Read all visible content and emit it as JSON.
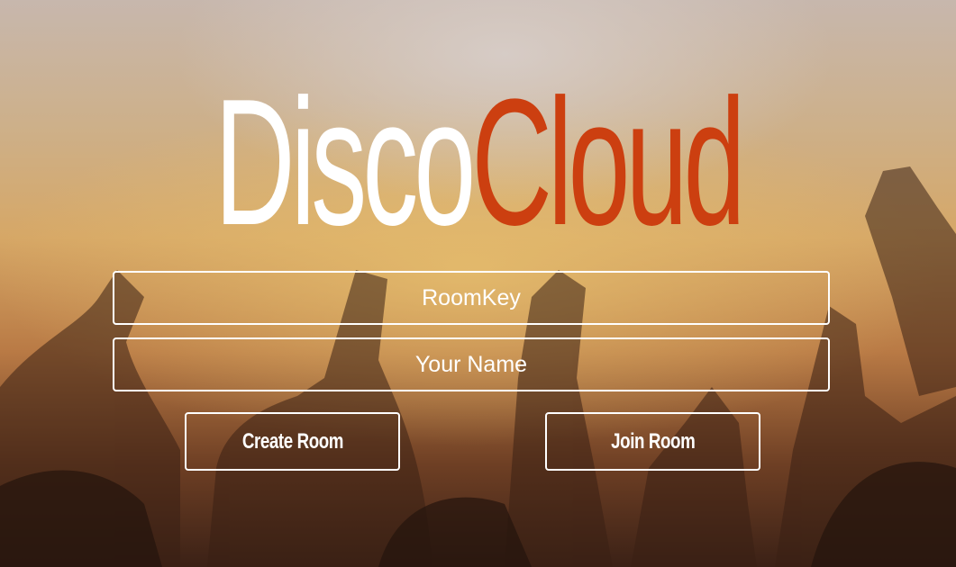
{
  "app": {
    "title_part1": "Disco",
    "title_part2": "Cloud"
  },
  "form": {
    "room_key_placeholder": "RoomKey",
    "your_name_placeholder": "Your Name",
    "room_key_value": "",
    "your_name_value": ""
  },
  "actions": {
    "create_label": "Create Room",
    "join_label": "Join Room"
  },
  "colors": {
    "brand_accent": "#cc3f10",
    "text": "#ffffff"
  }
}
